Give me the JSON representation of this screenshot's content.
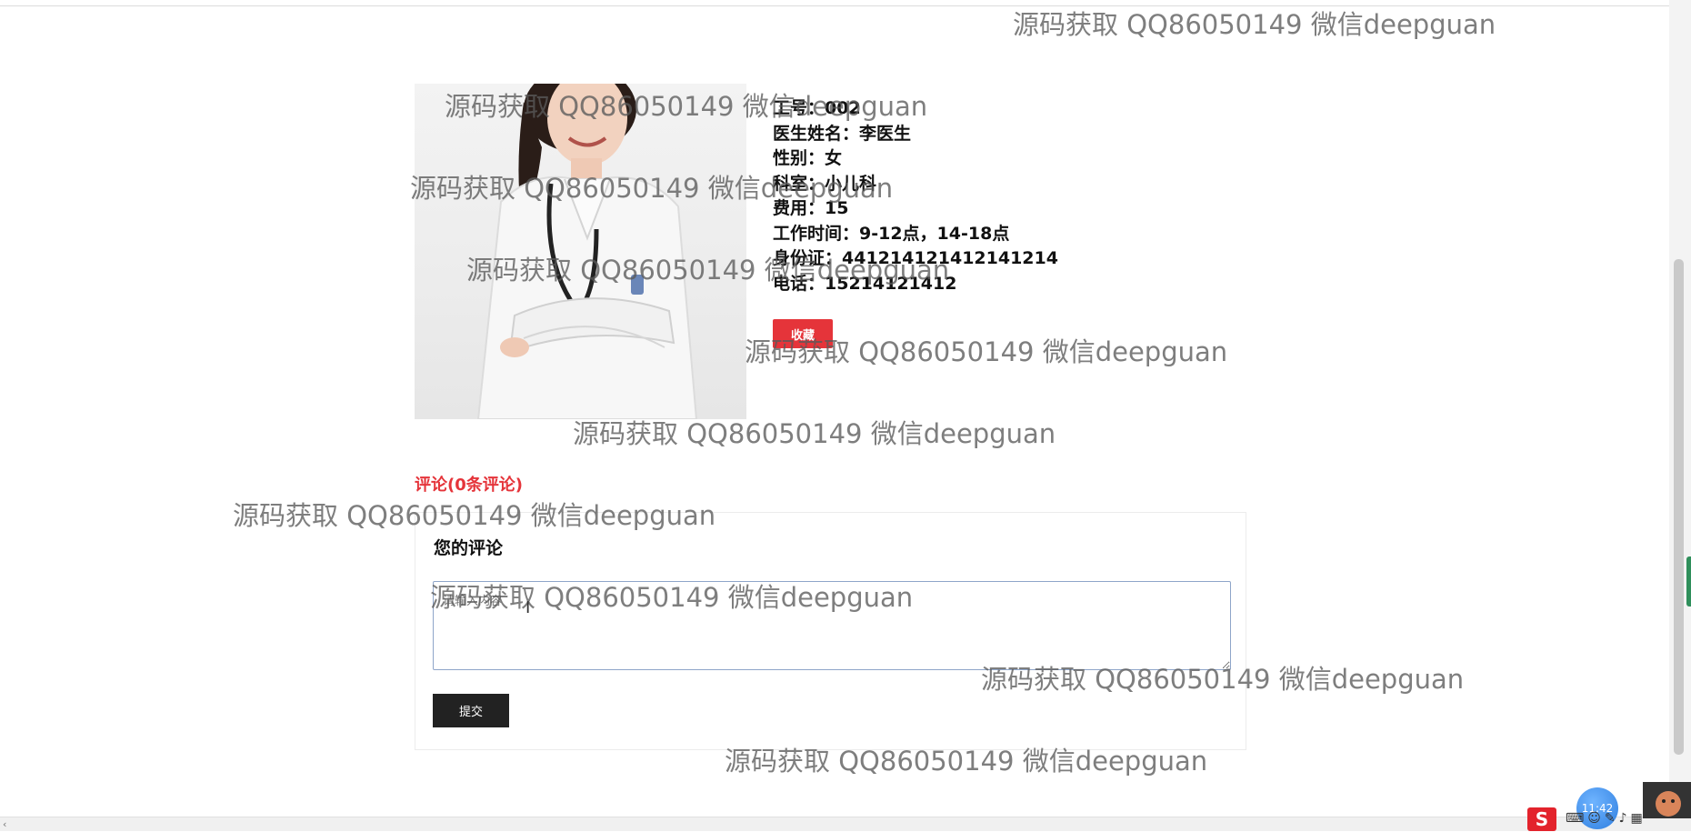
{
  "doctor": {
    "photo_alt": "医生照片",
    "info_lines": [
      "工号：002",
      "医生姓名：李医生",
      "性别：女",
      "科室：小儿科",
      "费用：15",
      "工作时间：9-12点，14-18点",
      "身份证：441214121412141214",
      "电话：15214121412"
    ],
    "favorite_label": "收藏"
  },
  "comments": {
    "count_label": "评论(0条评论)",
    "your_comment_label": "您的评论",
    "input_value": "",
    "input_placeholder": "请输入内容",
    "submit_label": "提交"
  },
  "watermark": {
    "text": "源码获取 QQ86050149 微信deepguan"
  },
  "taskbar": {
    "ime_label": "S",
    "clock": "11:42",
    "tray_icons": [
      "keyboard-icon",
      "emoji-icon",
      "pen-icon",
      "mic-icon",
      "grid-icon"
    ]
  },
  "colors": {
    "accent_red": "#e5343a",
    "submit_dark": "#222222",
    "input_border": "#8ea5c9"
  }
}
